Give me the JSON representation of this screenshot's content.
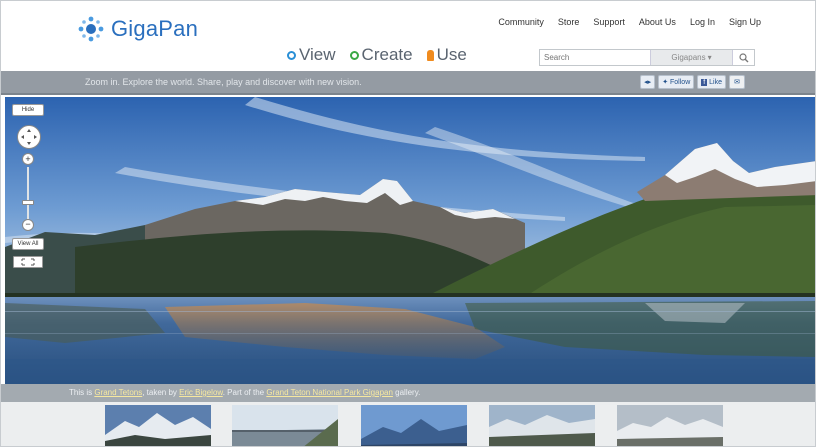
{
  "logo": {
    "text": "GigaPan"
  },
  "topnav": [
    "Community",
    "Store",
    "Support",
    "About Us",
    "Log In",
    "Sign Up"
  ],
  "modes": [
    {
      "label": "View",
      "icon": "view-ring-icon",
      "color": "#2a8fd6"
    },
    {
      "label": "Create",
      "icon": "create-ring-icon",
      "color": "#3aa845"
    },
    {
      "label": "Use",
      "icon": "use-pin-icon",
      "color": "#f08b1e"
    }
  ],
  "search": {
    "placeholder": "Search",
    "scope": "Gigapans",
    "button_icon": "search-icon"
  },
  "tagline": "Zoom in. Explore the world. Share, play and discover with new vision.",
  "social": {
    "follow": "Follow",
    "like": "Like",
    "mail_icon": "mail-icon"
  },
  "viewer_controls": {
    "hide": "Hide",
    "view_all": "View All",
    "pan_icon": "pan-icon",
    "fullscreen_icon": "fullscreen-icon"
  },
  "caption": {
    "prefix": "This is ",
    "title": "Grand Tetons",
    "taken_by": ", taken by ",
    "author": "Eric Bigelow",
    "part_of": ". Part of the ",
    "gallery": "Grand Teton National Park Gigapan",
    "suffix": " gallery."
  },
  "thumbnails": [
    {
      "name": "thumb-snowy-peaks"
    },
    {
      "name": "thumb-bridge"
    },
    {
      "name": "thumb-blue-range"
    },
    {
      "name": "thumb-valley-ridge"
    },
    {
      "name": "thumb-grey-range"
    }
  ],
  "colors": {
    "brand": "#2a6fbe",
    "bar": "#949ba3",
    "sky": "#3f7cc4",
    "water": "#3a6aa0"
  }
}
